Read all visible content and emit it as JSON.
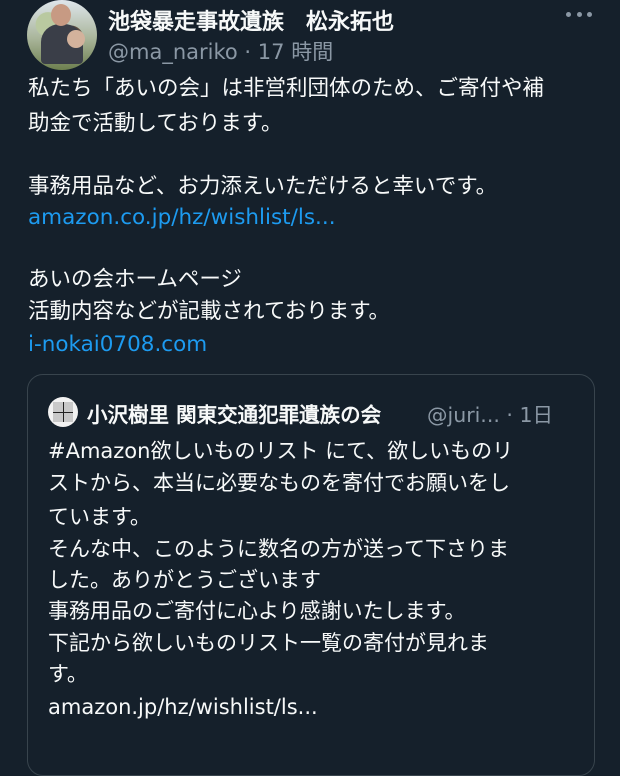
{
  "tweet": {
    "author_name": "池袋暴走事故遺族　松永拓也",
    "handle": "@ma_nariko",
    "time": "17 時間",
    "lines": [
      "私たち「あいの会」は非営利団体のため、ご寄付や補",
      "助金で活動しております。",
      "事務用品など、お力添えいただけると幸いです。",
      "あいの会ホームページ",
      "活動内容などが記載されております。"
    ],
    "link1": "amazon.co.jp/hz/wishlist/ls...",
    "link2": "i-nokai0708.com"
  },
  "quote": {
    "author_name": "小沢樹里 関東交通犯罪遺族の会",
    "handle": "@juri...",
    "time": "1日",
    "lines": [
      "#Amazon欲しいものリスト にて、欲しいものリ",
      "ストから、本当に必要なものを寄付でお願いをし",
      "ています。",
      "そんな中、このように数名の方が送って下さりま",
      "した。ありがとうございます",
      "事務用品のご寄付に心より感謝いたします。",
      "下記から欲しいものリスト一覧の寄付が見れま",
      "す。",
      "amazon.jp/hz/wishlist/ls..."
    ]
  },
  "icons": {
    "more": "more-horizontal-icon"
  },
  "colors": {
    "background": "#15202b",
    "link": "#1d9bf0",
    "muted": "#8b98a5"
  }
}
